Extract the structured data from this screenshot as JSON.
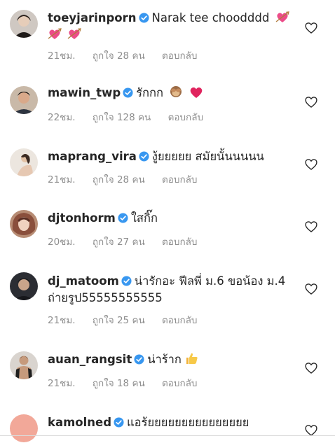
{
  "comments": [
    {
      "username": "toeyjarinporn",
      "text": "Narak tee choodddd",
      "emojis": [
        "heart-arrow-icon",
        "heart-arrow-icon",
        "heart-arrow-icon"
      ],
      "time": "21ชม.",
      "likes": "ถูกใจ 28 คน",
      "reply": "ตอบกลับ"
    },
    {
      "username": "mawin_twp",
      "text": "รักกก",
      "emojis": [
        "see-no-evil-monkey-icon",
        "red-heart-icon"
      ],
      "time": "22ชม.",
      "likes": "ถูกใจ 128 คน",
      "reply": "ตอบกลับ"
    },
    {
      "username": "maprang_vira",
      "text": "งู้ยยยยย สมัยนั้นนนนน",
      "emojis": [],
      "time": "21ชม.",
      "likes": "ถูกใจ 28 คน",
      "reply": "ตอบกลับ"
    },
    {
      "username": "djtonhorm",
      "text": "ใสกิ๊ก",
      "emojis": [],
      "time": "20ชม.",
      "likes": "ถูกใจ 27 คน",
      "reply": "ตอบกลับ"
    },
    {
      "username": "dj_matoom",
      "text": "น่ารักอะ ฟีลพี่ ม.6 ขอน้อง ม.4 ถ่ายรูป55555555555",
      "emojis": [],
      "time": "21ชม.",
      "likes": "ถูกใจ 25 คน",
      "reply": "ตอบกลับ"
    },
    {
      "username": "auan_rangsit",
      "text": "น่าร้าก",
      "emojis": [
        "thumbs-up-icon"
      ],
      "time": "21ชม.",
      "likes": "ถูกใจ 18 คน",
      "reply": "ตอบกลับ"
    },
    {
      "username": "kamolned",
      "text": "แอร้ยยยยยยยยยยยยยยย",
      "emojis": [],
      "time": "",
      "likes": "",
      "reply": ""
    }
  ],
  "colors": {
    "text": "#262626",
    "meta": "#8e8e8e",
    "verified": "#3897f0",
    "emoji_pink": "#ec4c89",
    "emoji_red": "#e0245e"
  }
}
